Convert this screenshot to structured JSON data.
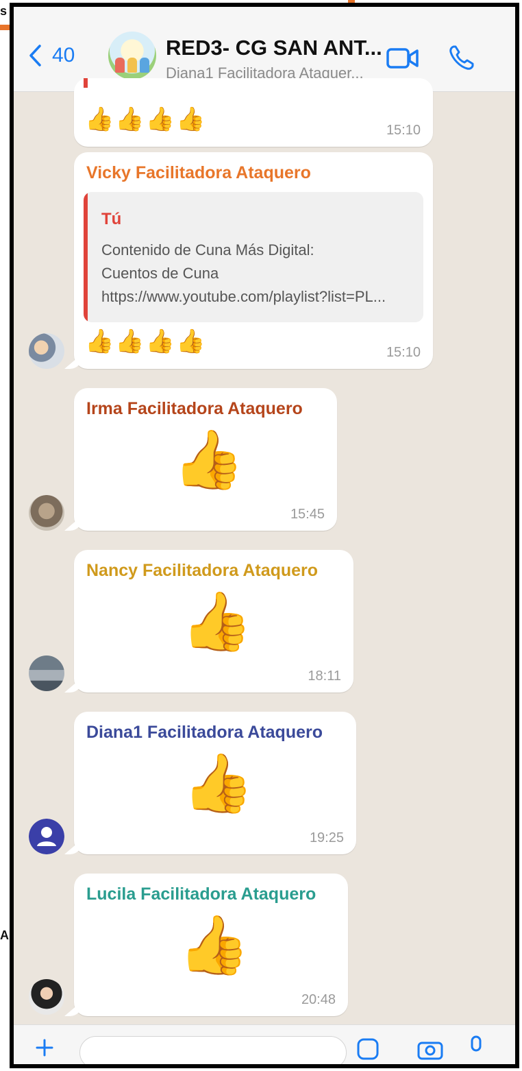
{
  "header": {
    "back_count": "40",
    "title": "RED3- CG SAN ANT...",
    "subtitle": "Diana1 Facilitadora Ataquer..."
  },
  "edge": {
    "top_left_char": "s",
    "mid_left_char": "A"
  },
  "messages": [
    {
      "id": "m1",
      "reaction": "👍👍👍👍",
      "time": "15:10"
    },
    {
      "id": "m2",
      "sender": "Vicky Facilitadora Ataquero",
      "sender_color": "#e8762a",
      "quote": {
        "author": "Tú",
        "lines": [
          "Contenido de Cuna Más Digital:",
          "Cuentos de Cuna",
          "https://www.youtube.com/playlist?list=PL..."
        ]
      },
      "reaction": "👍👍👍👍",
      "time": "15:10"
    },
    {
      "id": "m3",
      "sender": "Irma Facilitadora Ataquero",
      "sender_color": "#b5451b",
      "emoji": "👍",
      "time": "15:45"
    },
    {
      "id": "m4",
      "sender": "Nancy Facilitadora Ataquero",
      "sender_color": "#d09a1c",
      "emoji": "👍",
      "time": "18:11"
    },
    {
      "id": "m5",
      "sender": "Diana1 Facilitadora Ataquero",
      "sender_color": "#3b4a9a",
      "emoji": "👍",
      "time": "19:25"
    },
    {
      "id": "m6",
      "sender": "Lucila Facilitadora Ataquero",
      "sender_color": "#2a9d8f",
      "emoji": "👍",
      "time": "20:48"
    }
  ],
  "colors": {
    "accent": "#1a7cf3",
    "quote_bar": "#e0433a",
    "chat_bg": "#ebe5dd"
  }
}
